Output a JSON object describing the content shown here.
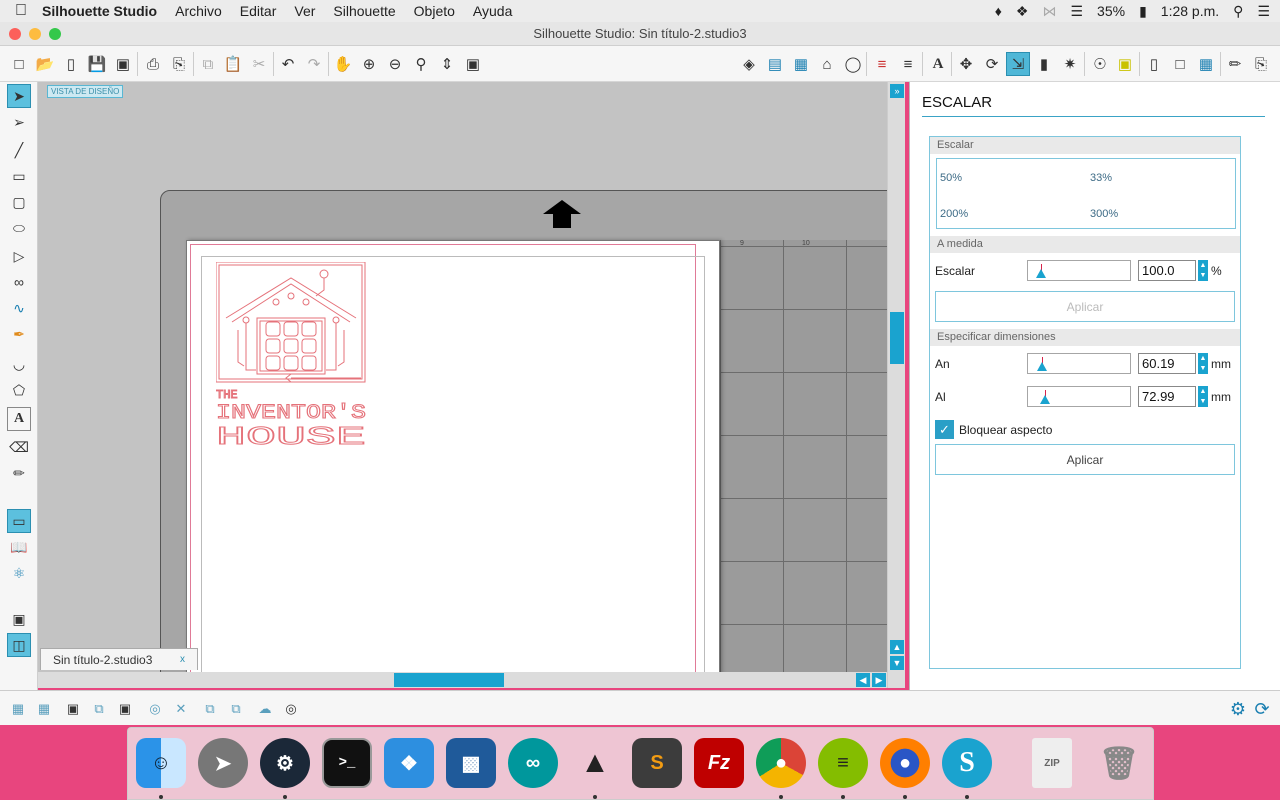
{
  "menubar": {
    "app_name": "Silhouette Studio",
    "items": [
      "Archivo",
      "Editar",
      "Ver",
      "Silhouette",
      "Objeto",
      "Ayuda"
    ],
    "battery": "35%",
    "clock": "1:28 p.m."
  },
  "window": {
    "title": "Silhouette Studio: Sin título-2.studio3"
  },
  "canvas": {
    "view_badge": "VISTA DE DISEÑO",
    "ruler_marks": [
      "9",
      "10"
    ],
    "design_text_line1": "THE",
    "design_text_line2": "INVENTOR'S",
    "design_text_line3": "HOUSE"
  },
  "doc_tab": {
    "name": "Sin título-2.studio3",
    "close": "x"
  },
  "panel": {
    "title": "ESCALAR",
    "section_scale": "Escalar",
    "presets": [
      "50%",
      "33%",
      "200%",
      "300%"
    ],
    "section_custom": "A medida",
    "scale_label": "Escalar",
    "scale_value": "100.0",
    "scale_unit": "%",
    "apply_disabled": "Aplicar",
    "section_dimensions": "Especificar dimensiones",
    "width_label": "An",
    "width_value": "60.19",
    "height_label": "Al",
    "height_value": "72.99",
    "dim_unit": "mm",
    "lock_label": "Bloquear aspecto",
    "lock_checked": true,
    "apply": "Aplicar"
  },
  "icons": {
    "toolbar": [
      "new-icon",
      "open-icon",
      "template-icon",
      "save-icon",
      "save-library-icon",
      "print-icon",
      "send-icon",
      "copy-icon",
      "paste-icon",
      "cut-icon",
      "undo-icon",
      "redo-icon",
      "pan-icon",
      "zoom-in-icon",
      "zoom-out-icon",
      "zoom-box-icon",
      "fit-icon",
      "fit-page-icon",
      "fill-icon",
      "gradient-icon",
      "pattern-icon",
      "line-style-icon",
      "line-color-icon",
      "lines-icon",
      "dashes-icon",
      "text-icon",
      "transform-icon",
      "rotate-icon",
      "scale-icon",
      "align-icon",
      "replicate-icon",
      "trace-icon",
      "offset-icon",
      "page-setup-icon",
      "cut-settings-icon",
      "grid-icon",
      "knife-icon",
      "send-to-cutter-icon"
    ],
    "accent": "#1aa3cf"
  }
}
